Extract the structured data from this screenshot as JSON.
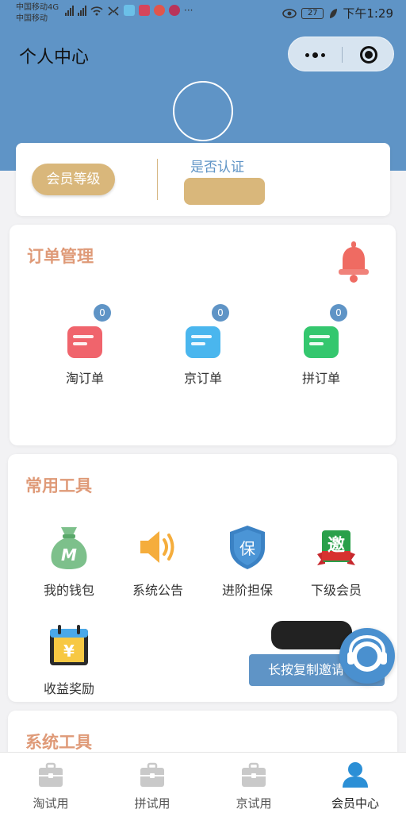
{
  "status_bar": {
    "carrier_1": "中国移动4G",
    "carrier_2": "中国移动",
    "battery": "27",
    "time": "下午1:29"
  },
  "header": {
    "title": "个人中心"
  },
  "member_card": {
    "level_label": "会员等级",
    "verify_label": "是否认证"
  },
  "orders": {
    "title": "订单管理",
    "items": [
      {
        "label": "淘订单",
        "count": "0",
        "color": "#f0646c"
      },
      {
        "label": "京订单",
        "count": "0",
        "color": "#4ab6ee"
      },
      {
        "label": "拼订单",
        "count": "0",
        "color": "#34c76e"
      }
    ]
  },
  "tools": {
    "title": "常用工具",
    "items": [
      {
        "label": "我的钱包",
        "icon": "wallet-bag-icon"
      },
      {
        "label": "系统公告",
        "icon": "speaker-icon"
      },
      {
        "label": "进阶担保",
        "icon": "shield-icon"
      },
      {
        "label": "下级会员",
        "icon": "invite-badge-icon"
      },
      {
        "label": "收益奖励",
        "icon": "calendar-yen-icon"
      }
    ],
    "shield_char": "保",
    "invite_char": "邀",
    "yen_char": "¥",
    "wallet_char": "M",
    "invite_button": "长按复制邀请"
  },
  "system_tools": {
    "title": "系统工具"
  },
  "tab_bar": {
    "tabs": [
      {
        "label": "淘试用",
        "active": false
      },
      {
        "label": "拼试用",
        "active": false
      },
      {
        "label": "京试用",
        "active": false
      },
      {
        "label": "会员中心",
        "active": true
      }
    ]
  },
  "colors": {
    "header_blue": "#5f94c6",
    "gold": "#d9b77b",
    "section_title": "#df9a78"
  }
}
